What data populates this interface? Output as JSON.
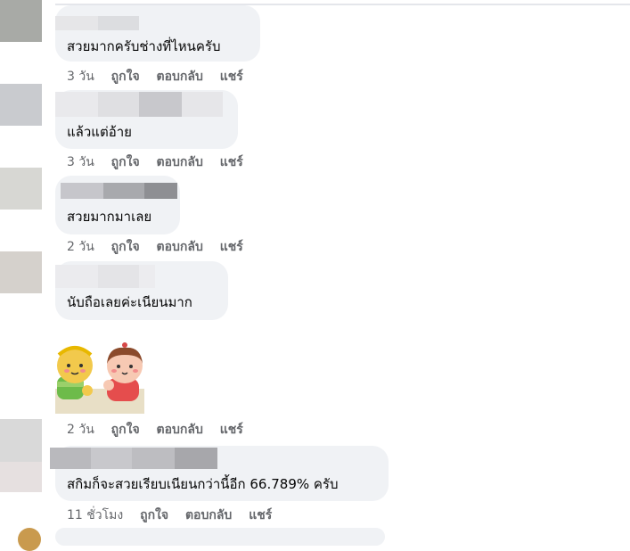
{
  "comments": [
    {
      "text": "สวยมากครับช่างที่ไหนครับ",
      "time": "3 วัน",
      "like": "ถูกใจ",
      "reply": "ตอบกลับ",
      "share": "แชร์"
    },
    {
      "text": "แล้วแต่อ้าย",
      "time": "3 วัน",
      "like": "ถูกใจ",
      "reply": "ตอบกลับ",
      "share": "แชร์"
    },
    {
      "text": "สวยมากมาเลย",
      "time": "2 วัน",
      "like": "ถูกใจ",
      "reply": "ตอบกลับ",
      "share": "แชร์"
    },
    {
      "text": "นับถือเลยค่ะเนียนมาก",
      "time": "2 วัน",
      "like": "ถูกใจ",
      "reply": "ตอบกลับ",
      "share": "แชร์"
    },
    {
      "text": "",
      "time": "2 วัน",
      "like": "ถูกใจ",
      "reply": "ตอบกลับ",
      "share": "แชร์"
    },
    {
      "text": "สกิมก็จะสวยเรียบเนียนกว่านี้อีก 66.789% ครับ",
      "time": "11 ชั่วโมง",
      "like": "ถูกใจ",
      "reply": "ตอบกลับ",
      "share": "แชร์"
    }
  ],
  "icons": {
    "sticker": "two-cartoon-kids-sticker-icon"
  },
  "colors": {
    "bubble_bg": "#f0f2f5",
    "action_text": "#65676b"
  }
}
